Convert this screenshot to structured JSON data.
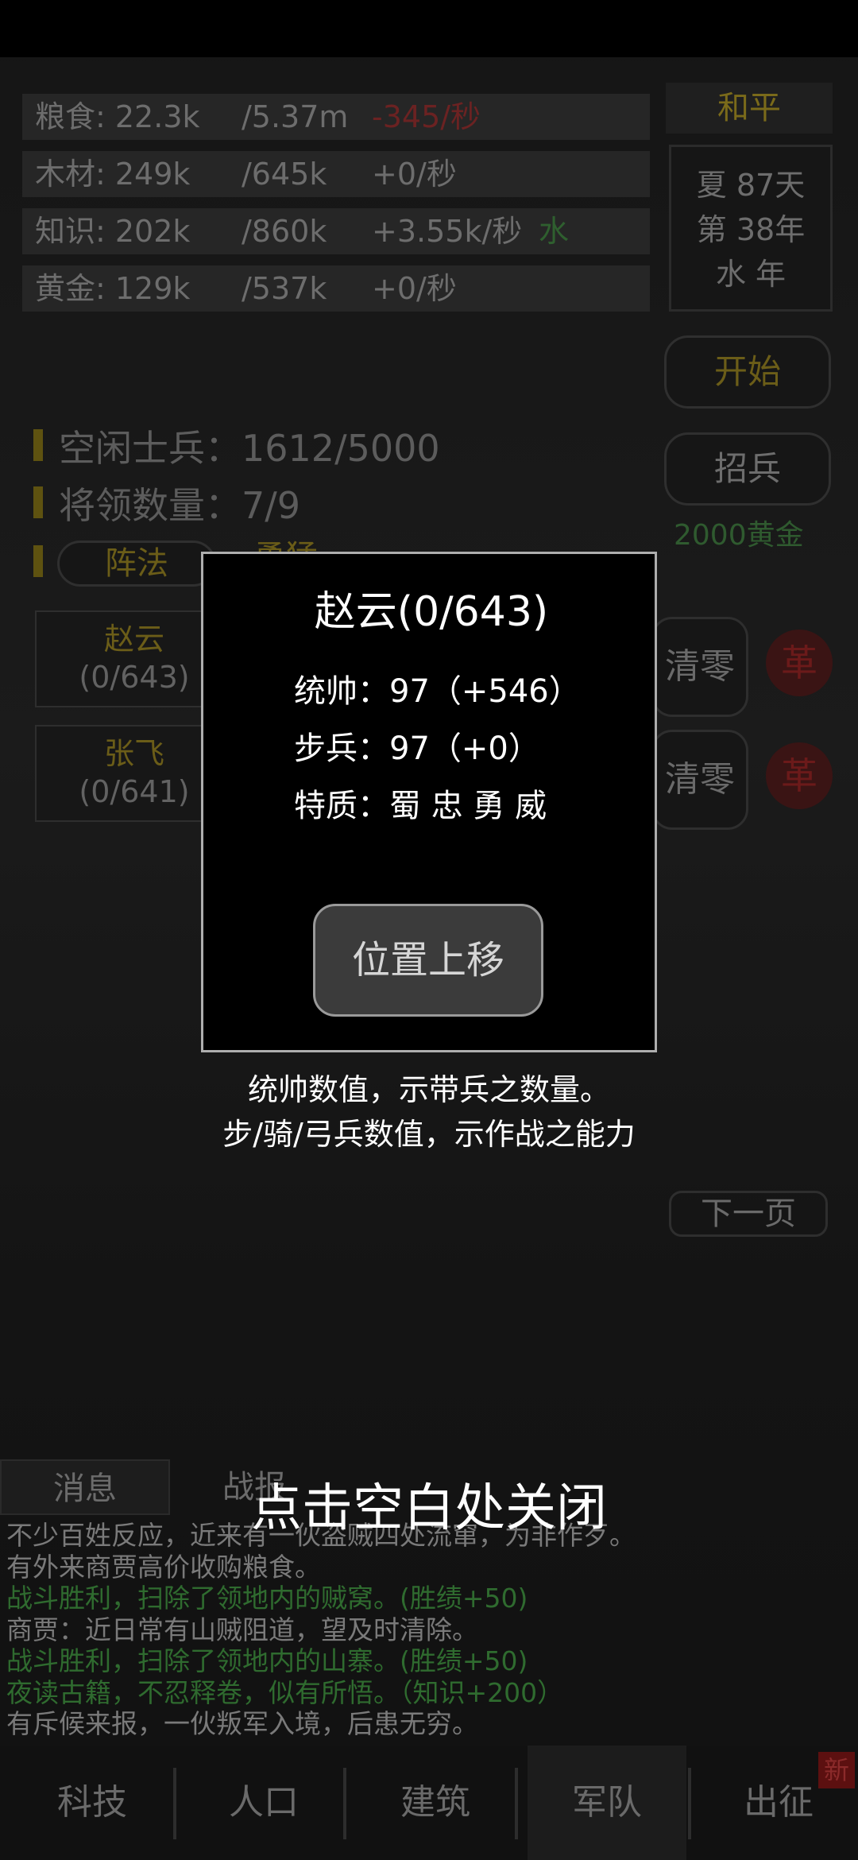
{
  "resources": [
    {
      "name": "粮食: 22.3k",
      "cap": "/5.37m",
      "rate": "-345/秒",
      "extra": ""
    },
    {
      "name": "木材: 249k",
      "cap": "/645k",
      "rate": "+0/秒",
      "extra": ""
    },
    {
      "name": "知识: 202k",
      "cap": "/860k",
      "rate": "+3.55k/秒",
      "extra": "水"
    },
    {
      "name": "黄金: 129k",
      "cap": "/537k",
      "rate": "+0/秒",
      "extra": ""
    }
  ],
  "status": {
    "peace": "和平",
    "season": "夏 87天",
    "year": "第 38年",
    "element_year": "水 年"
  },
  "buttons": {
    "start": "开始",
    "recruit": "招兵",
    "recruit_cost": "2000黄金",
    "next_page": "下一页",
    "clear": "清零",
    "ge": "革"
  },
  "army": {
    "idle_soldiers": "空闲士兵：1612/5000",
    "general_count": "将领数量：7/9",
    "formation_button": "阵法",
    "formation_value": "勇猛"
  },
  "generals": [
    {
      "name": "赵云",
      "value": "(0/643)"
    },
    {
      "name": "张飞",
      "value": "(0/641)"
    }
  ],
  "log_tabs": {
    "messages": "消息",
    "record": "战报"
  },
  "log": [
    {
      "text": "不少百姓反应，近来有一伙盗贼四处流窜，为非作歹。",
      "color": "#7a7a7a"
    },
    {
      "text": "有外来商贾高价收购粮食。",
      "color": "#7a7a7a"
    },
    {
      "text": "战斗胜利，扫除了领地内的贼窝。(胜绩+50)",
      "color": "#2f6b2f"
    },
    {
      "text": "商贾：近日常有山贼阻道，望及时清除。",
      "color": "#7a7a7a"
    },
    {
      "text": "战斗胜利，扫除了领地内的山寨。(胜绩+50)",
      "color": "#2f6b2f"
    },
    {
      "text": "夜读古籍，不忍释卷，似有所悟。（知识+200）",
      "color": "#2f6b2f"
    },
    {
      "text": "有斥候来报，一伙叛军入境，后患无穷。",
      "color": "#7a7a7a"
    }
  ],
  "nav": [
    "科技",
    "人口",
    "建筑",
    "军队",
    "出征"
  ],
  "nav_badge": "新",
  "modal": {
    "title": "赵云(0/643)",
    "command": "统帅：97（+546）",
    "infantry": "步兵：97（+0）",
    "traits": "特质：蜀 忠 勇 威",
    "move_up": "位置上移"
  },
  "hints": {
    "line1": "统帅数值，示带兵之数量。",
    "line2": "步/骑/弓兵数值，示作战之能力"
  },
  "close_hint": "点击空白处关闭",
  "colors": {
    "gold_text": "#7a6a1a",
    "log_green": "#2f6b2f",
    "rate_red": "#6b2222",
    "element_green": "#2f5f2f"
  }
}
